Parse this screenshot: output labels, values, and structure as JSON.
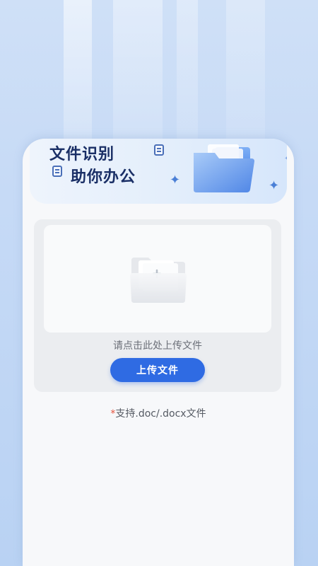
{
  "banner": {
    "title_line1": "文件识别",
    "title_line2": "助你办公"
  },
  "upload": {
    "hint": "请点击此处上传文件",
    "button_label": "上传文件",
    "required_mark": "*",
    "support_text": "支持.doc/.docx文件"
  },
  "colors": {
    "accent": "#2f6be3",
    "title": "#1a2f66",
    "required": "#e5533d"
  },
  "icons": [
    "document-icon",
    "sparkle-icon",
    "folder-illustration",
    "empty-folder-icon"
  ]
}
